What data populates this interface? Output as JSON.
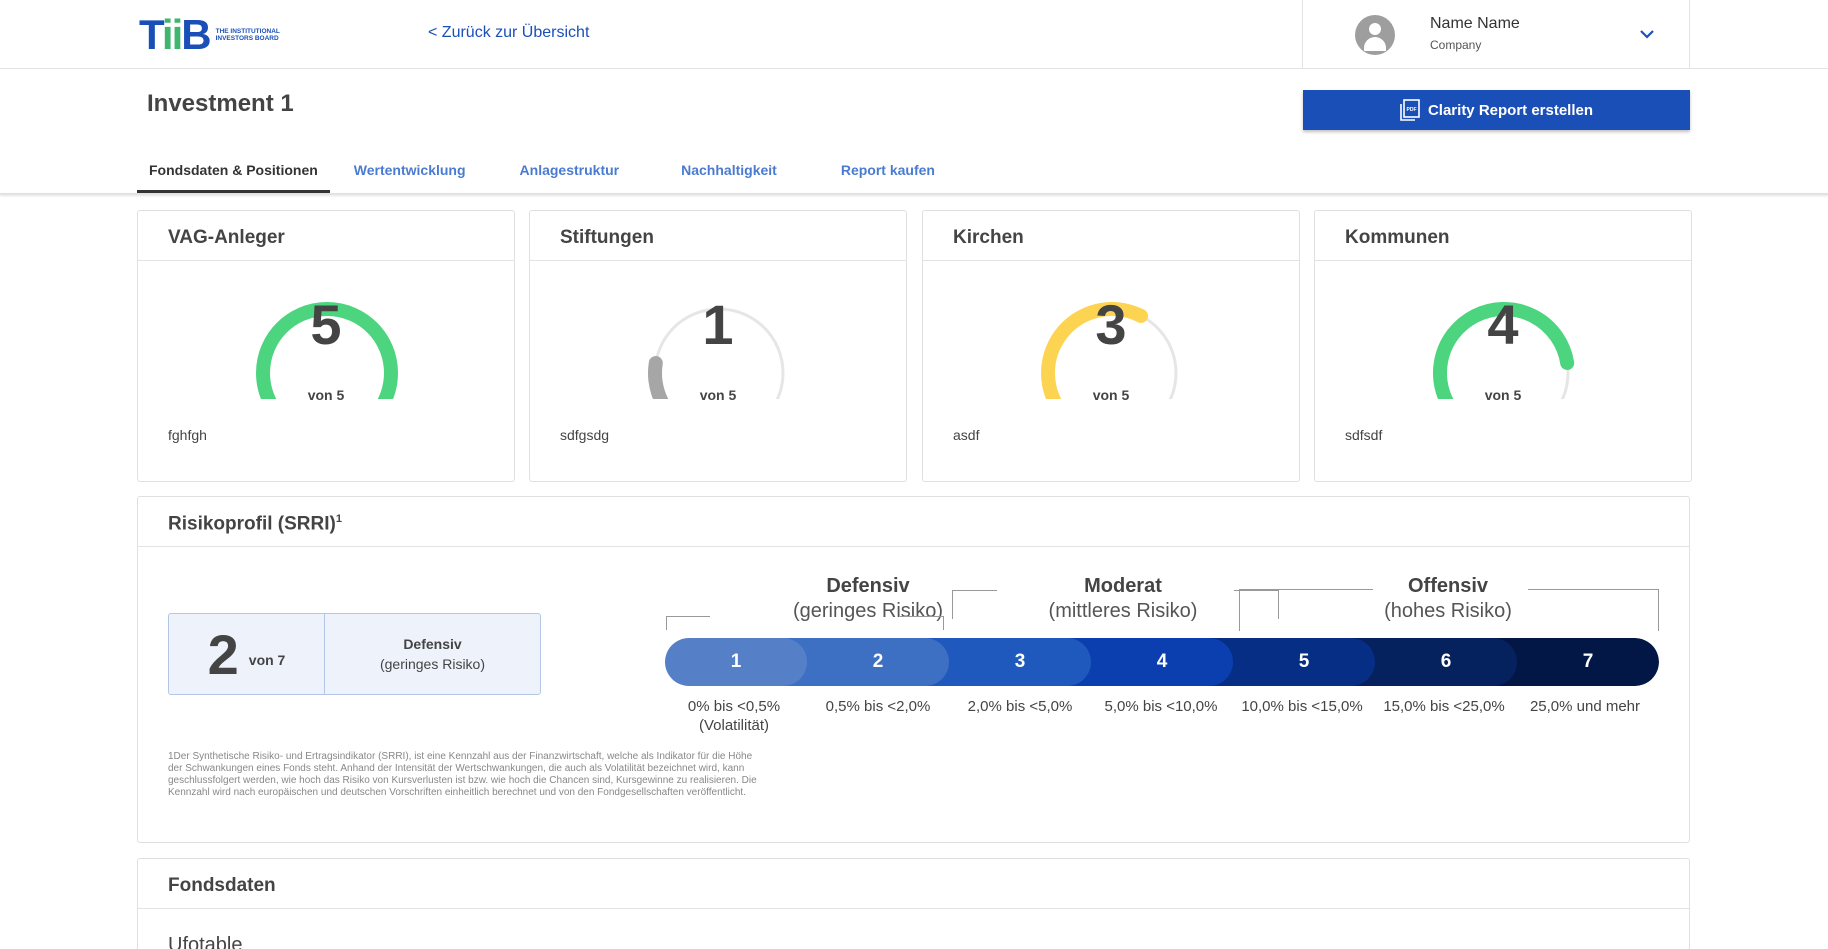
{
  "header": {
    "logo_letters": [
      "T",
      "i",
      "i",
      "B"
    ],
    "logo_text": "The Institutional Investors Board",
    "back_link": "< Zurück zur Übersicht",
    "user_name": "Name Name",
    "user_company": "Company"
  },
  "page": {
    "title": "Investment 1",
    "report_button": "Clarity Report erstellen"
  },
  "tabs": [
    {
      "label": "Fondsdaten & Positionen",
      "active": true
    },
    {
      "label": "Wertentwicklung",
      "active": false
    },
    {
      "label": "Anlagestruktur",
      "active": false
    },
    {
      "label": "Nachhaltigkeit",
      "active": false
    },
    {
      "label": "Report kaufen",
      "active": false
    }
  ],
  "gauges": [
    {
      "title": "VAG-Anleger",
      "value": 5,
      "max": 5,
      "von": "von 5",
      "note": "fghfgh",
      "color": "#4cd47e"
    },
    {
      "title": "Stiftungen",
      "value": 1,
      "max": 5,
      "von": "von 5",
      "note": "sdfgsdg",
      "color": "#a6a6a6"
    },
    {
      "title": "Kirchen",
      "value": 3,
      "max": 5,
      "von": "von 5",
      "note": "asdf",
      "color": "#fdd451"
    },
    {
      "title": "Kommunen",
      "value": 4,
      "max": 5,
      "von": "von 5",
      "note": "sdfsdf",
      "color": "#4cd47e"
    }
  ],
  "gauge_track_color": "#e6e6e6",
  "risk": {
    "title": "Risikoprofil (SRRI)",
    "title_sup": "1",
    "score": "2",
    "score_von": "von 7",
    "score_category": "Defensiv",
    "score_category_sub": "(geringes Risiko)",
    "groups": [
      {
        "title": "Defensiv",
        "sub": "(geringes Risiko)"
      },
      {
        "title": "Moderat",
        "sub": "(mittleres Risiko)"
      },
      {
        "title": "Offensiv",
        "sub": "(hohes Risiko)"
      }
    ],
    "segments": [
      {
        "label": "1",
        "color": "#5580c8",
        "range": "0% bis <0,5%",
        "range_sub": "(Volatilität)"
      },
      {
        "label": "2",
        "color": "#3d6fc3",
        "range": "0,5% bis <2,0%",
        "range_sub": ""
      },
      {
        "label": "3",
        "color": "#2059bd",
        "range": "2,0% bis <5,0%",
        "range_sub": ""
      },
      {
        "label": "4",
        "color": "#0b3fb0",
        "range": "5,0% bis <10,0%",
        "range_sub": ""
      },
      {
        "label": "5",
        "color": "#062e85",
        "range": "10,0% bis <15,0%",
        "range_sub": ""
      },
      {
        "label": "6",
        "color": "#05225f",
        "range": "15,0% bis <25,0%",
        "range_sub": ""
      },
      {
        "label": "7",
        "color": "#031746",
        "range": "25,0% und mehr",
        "range_sub": ""
      }
    ],
    "footnote": "1Der Synthetische Risiko- und Ertragsindikator (SRRI), ist eine Kennzahl aus der Finanzwirtschaft, welche als Indikator für die Höhe der Schwankungen eines Fonds steht. Anhand der Intensität der Wertschwankungen, die auch als Volatilität bezeichnet wird, kann geschlussfolgert werden, wie hoch das Risiko von Kursverlusten ist bzw. wie hoch die Chancen sind, Kursgewinne zu realisieren. Die Kennzahl wird nach europäischen und deutschen Vorschriften einheitlich berechnet und von den Fondgesellschaften veröffentlicht."
  },
  "fonds": {
    "title": "Fondsdaten",
    "subtitle": "Ufotable"
  }
}
